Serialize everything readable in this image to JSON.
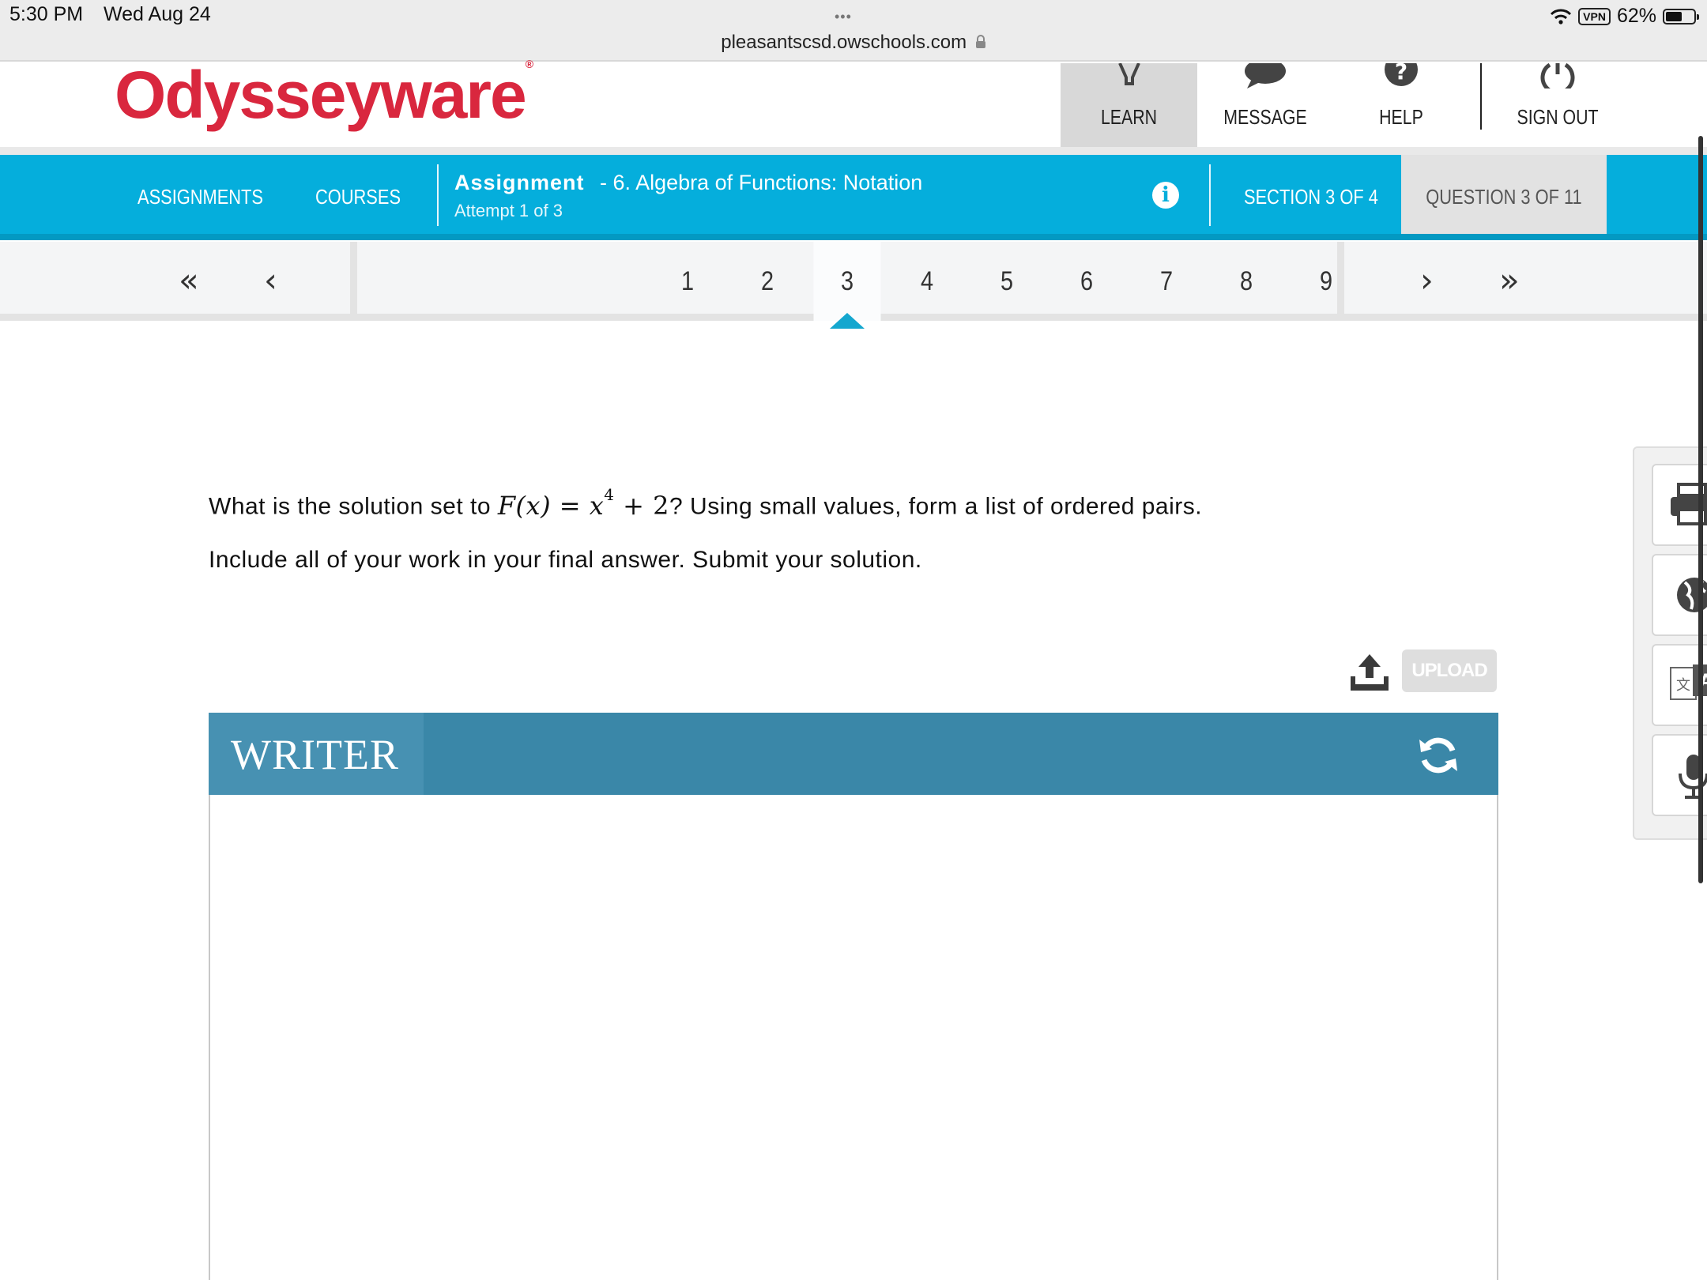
{
  "status_bar": {
    "time": "5:30 PM",
    "date": "Wed Aug 24",
    "dots": "•••",
    "url": "pleasantscsd.owschools.com",
    "vpn": "VPN",
    "battery": "62%"
  },
  "header": {
    "logo": "Odysseyware",
    "logo_mark": "®",
    "nav": {
      "learn": "LEARN",
      "message": "MESSAGE",
      "help": "HELP",
      "sign_out": "SIGN OUT"
    }
  },
  "assignment_bar": {
    "assignments": "ASSIGNMENTS",
    "courses": "COURSES",
    "title_prefix": "Assignment",
    "title": "- 6. Algebra of Functions: Notation",
    "attempt": "Attempt 1 of 3",
    "info": "i",
    "section": "SECTION 3 OF 4",
    "question": "QUESTION 3 OF 11"
  },
  "pager": {
    "first": "«",
    "prev": "‹",
    "next": "›",
    "last": "»",
    "numbers": [
      "1",
      "2",
      "3",
      "4",
      "5",
      "6",
      "7",
      "8",
      "9"
    ],
    "active": "3"
  },
  "question": {
    "line1_before": "What is the solution set to ",
    "math_lhs": "F(x) = x",
    "math_exp": "4",
    "math_rhs": " + 2",
    "line1_after": "? Using small values, form a list of ordered pairs.",
    "line2": "Include all of your work in your final answer. Submit your solution."
  },
  "upload": {
    "label": "UPLOAD"
  },
  "writer": {
    "title": "WRITER"
  },
  "colors": {
    "brand_red": "#d9273e",
    "bar_blue": "#05aedc",
    "writer_blue": "#3a87a8"
  }
}
